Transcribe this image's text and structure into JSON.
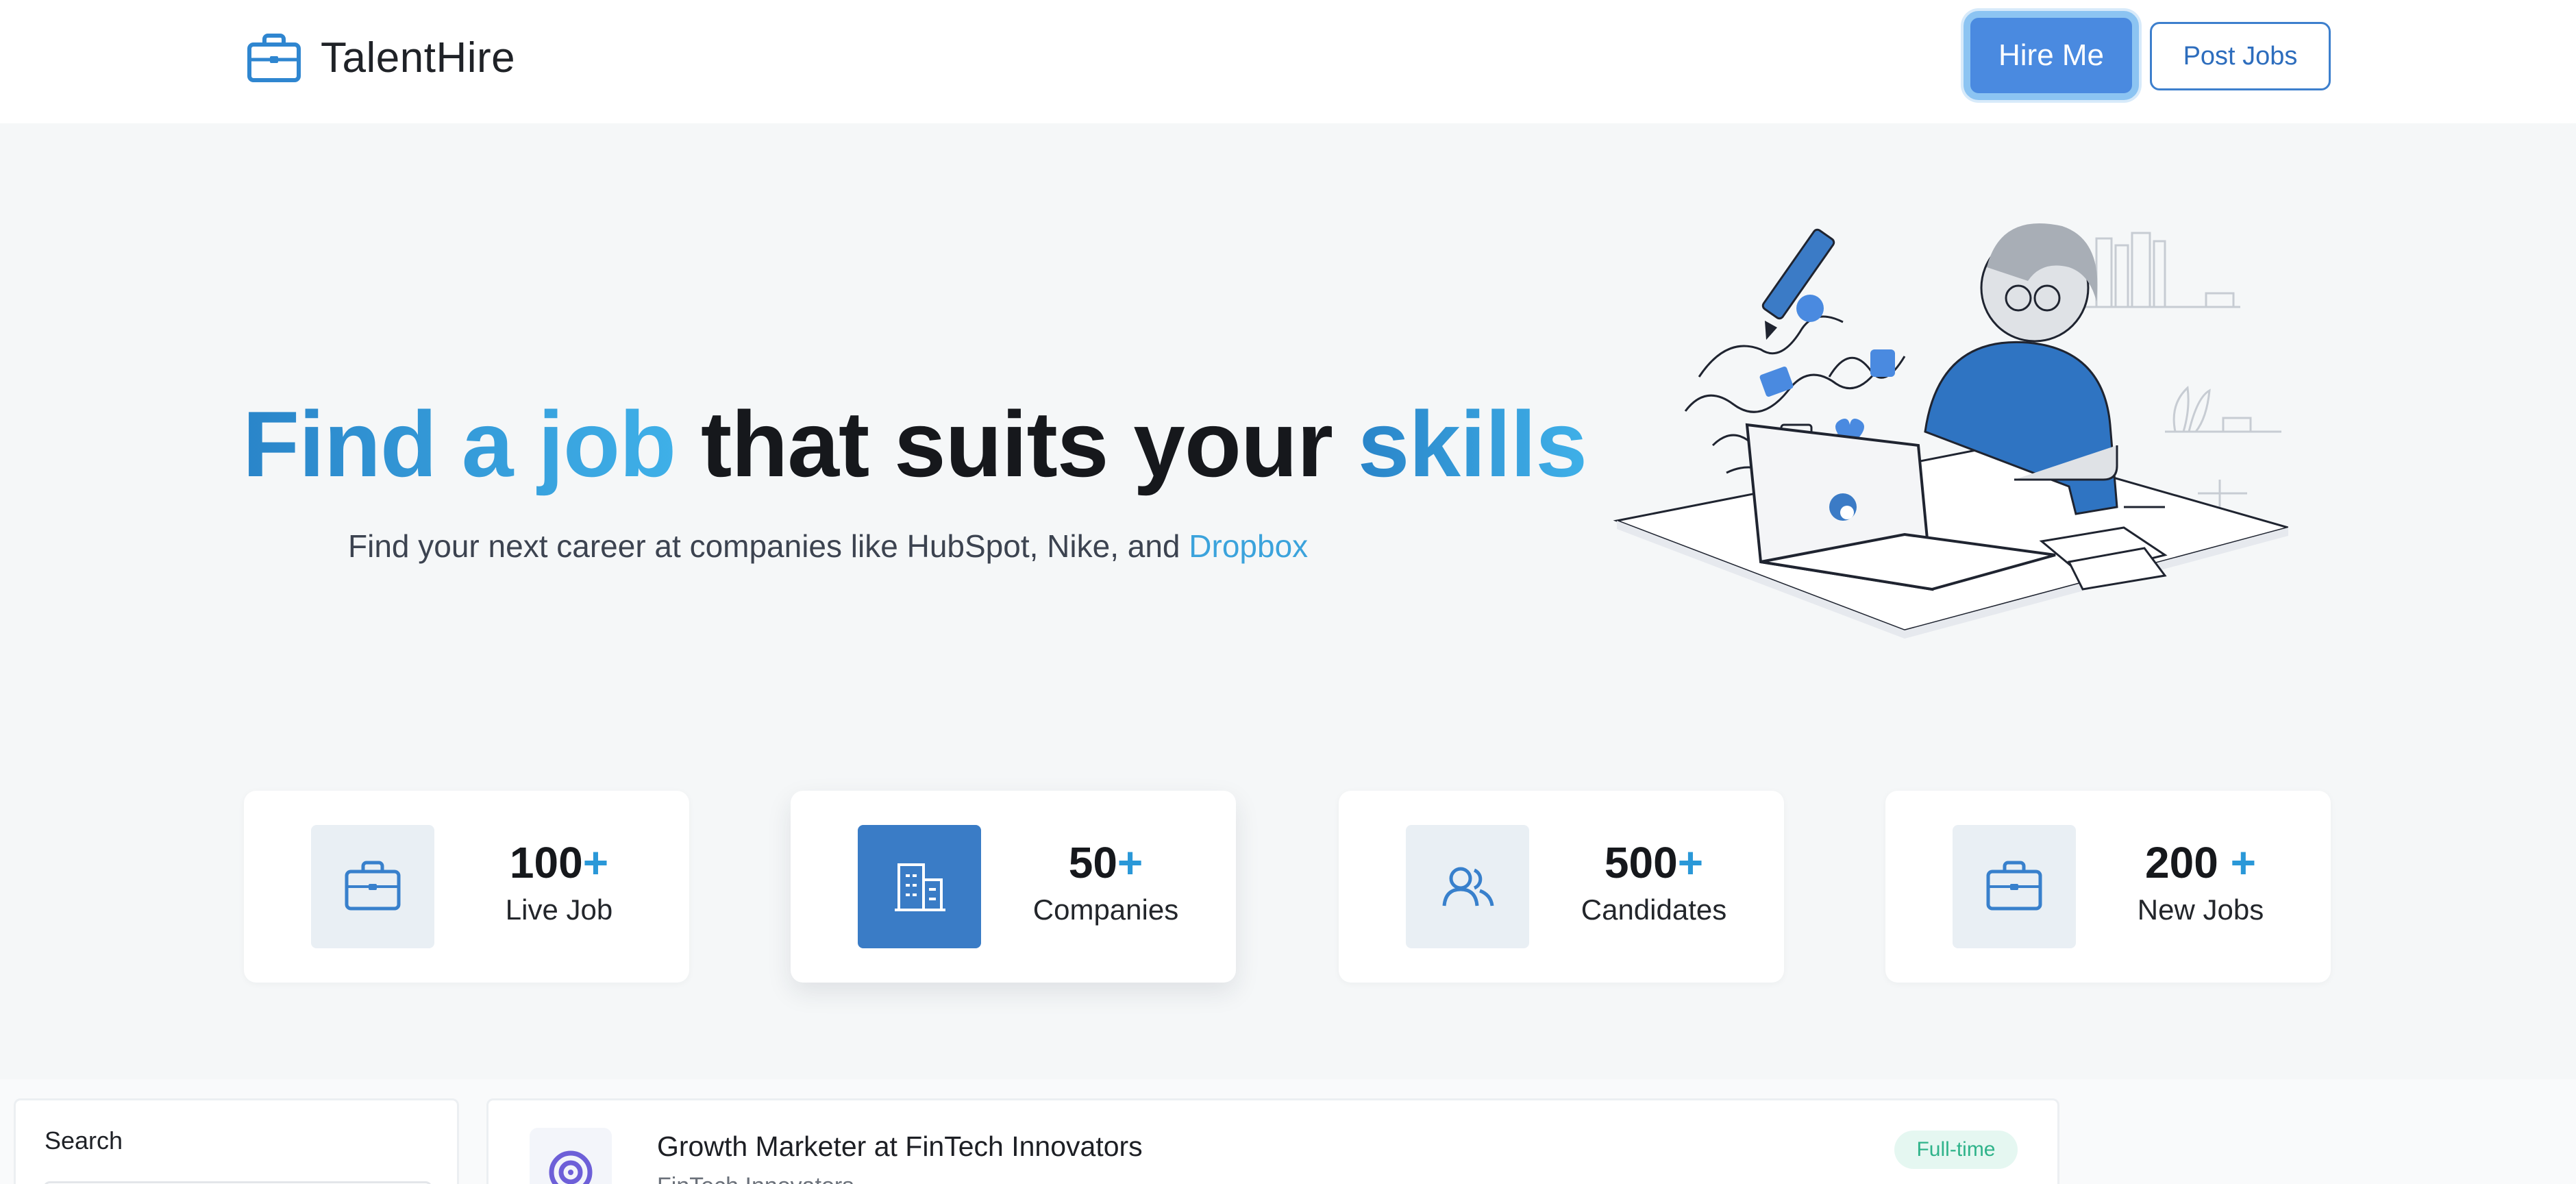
{
  "header": {
    "brand": "TalentHire",
    "hire_label": "Hire Me",
    "post_label": "Post Jobs"
  },
  "hero": {
    "title_parts": [
      "Find a job",
      "that suits your",
      "skills"
    ],
    "subtitle_prefix": "Find your next career at companies like HubSpot, Nike, and ",
    "subtitle_highlight": "Dropbox"
  },
  "stats": [
    {
      "number": "100",
      "plus": "+",
      "label": "Live Job",
      "icon": "briefcase-icon"
    },
    {
      "number": "50",
      "plus": "+",
      "label": "Companies",
      "icon": "building-icon"
    },
    {
      "number": "500",
      "plus": "+",
      "label": "Candidates",
      "icon": "users-icon"
    },
    {
      "number": "200 ",
      "plus": "+",
      "label": "New Jobs",
      "icon": "briefcase-icon"
    }
  ],
  "sidebar": {
    "search_label": "Search"
  },
  "jobs": [
    {
      "title": "Growth Marketer at FinTech Innovators",
      "company": "FinTech Innovators",
      "type": "Full-time"
    }
  ],
  "colors": {
    "primary": "#3a7cc6",
    "accent": "#3fb0e8",
    "tag_green": "#2fb38a"
  }
}
